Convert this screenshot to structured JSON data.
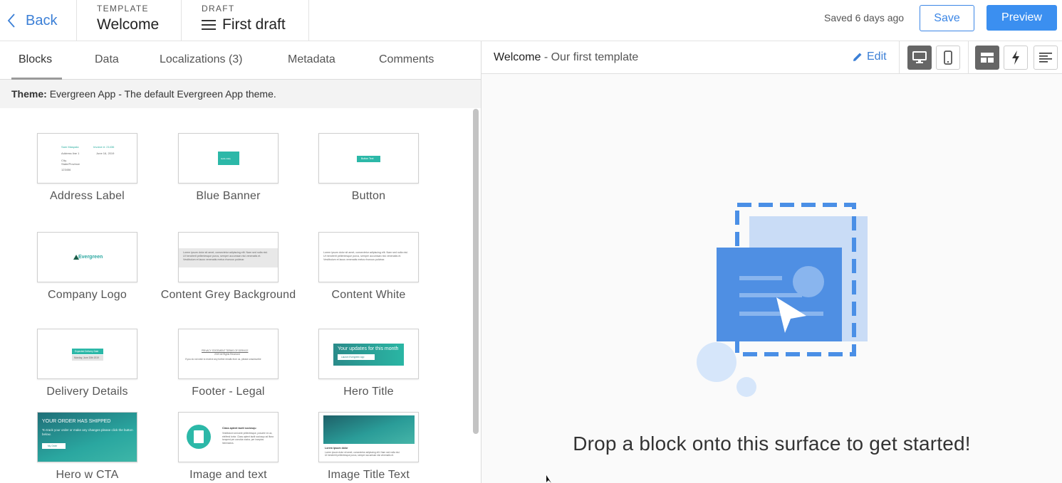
{
  "header": {
    "back_label": "Back",
    "template_caption": "TEMPLATE",
    "template_name": "Welcome",
    "draft_caption": "DRAFT",
    "draft_name": "First draft",
    "saved_status": "Saved 6 days ago",
    "save_label": "Save",
    "preview_label": "Preview"
  },
  "tabs": [
    {
      "label": "Blocks"
    },
    {
      "label": "Data"
    },
    {
      "label": "Localizations (3)"
    },
    {
      "label": "Metadata"
    },
    {
      "label": "Comments"
    }
  ],
  "theme": {
    "label": "Theme:",
    "value": "Evergreen App - The default Evergreen App theme."
  },
  "blocks": [
    {
      "label": "Address Label"
    },
    {
      "label": "Blue Banner"
    },
    {
      "label": "Button"
    },
    {
      "label": "Company Logo"
    },
    {
      "label": "Content Grey Background"
    },
    {
      "label": "Content White"
    },
    {
      "label": "Delivery Details"
    },
    {
      "label": "Footer - Legal"
    },
    {
      "label": "Hero Title"
    },
    {
      "label": "Hero w CTA"
    },
    {
      "label": "Image and text"
    },
    {
      "label": "Image Title Text"
    }
  ],
  "thumbs": {
    "address_name": "Sam Maspala",
    "address_invoice": "Invoice #: 21436",
    "address_line": "Address line 1",
    "address_date": "June 16, 2019",
    "address_city": "City,",
    "address_state": "State/Province",
    "address_zip": "123456",
    "banner_text": "Hello daily",
    "button_text": "Button Text",
    "logo_text": "Evergreen",
    "lorem_1": "Lorem ipsum dolor sit amet, consectetur adipiscing elit. Nam sed nulla nisl.",
    "lorem_2": "Ut hendrerit pellentesque purus, semper accumsan nisi venenatis et.",
    "lorem_3": "Vestibulum et lacus venenatis metus rhoncus pulvinar.",
    "delivery_title": "Expected Delivery Date",
    "delivery_date": "Monday, June 20th 2019",
    "footer_links": "PRIVACY STATEMENT     TERMS OF SERVICE",
    "footer_rights": "2019 All Rights Reserved",
    "footer_unsub": "If you do not wish to receive any further emails from us, please unsubscribe",
    "hero_title": "Your updates for this month",
    "hero_button": "Launch Evergreen App",
    "cta_title": "YOUR ORDER HAS SHIPPED",
    "cta_body": "To track your order or make any changes please click the button below.",
    "cta_button": "My Order",
    "imgtext_title": "Class aptent taciti sociosqu",
    "imgtext_body": "Vestibulum sed ante pellentesque, posuere ex ac, eleifend tortor. Class aptent taciti sociosqu ad litora torquent per conubia nostra, per inceptos himenaeos.",
    "imgtitle_title": "Lorem ipsum dolor"
  },
  "preview": {
    "title": "Welcome",
    "separator": " - ",
    "subtitle": "Our first template",
    "edit_label": "Edit",
    "empty_message": "Drop a block onto this surface to get started!"
  },
  "colors": {
    "accent": "#3b8ff0",
    "teal": "#2cb8a8",
    "illustration_blue": "#4a8fe6"
  }
}
